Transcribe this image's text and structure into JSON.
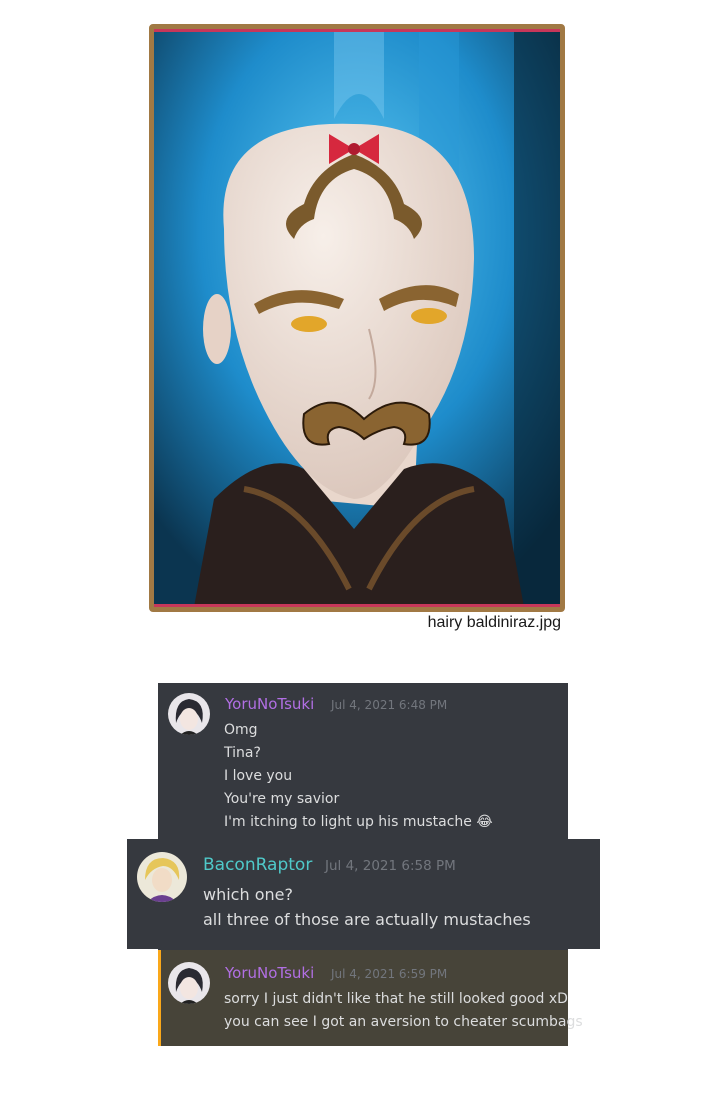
{
  "image_caption": "hairy baldiniraz.jpg",
  "colors": {
    "chat_bg": "#36393f",
    "yoru_name": "#b16fe3",
    "bacon_name": "#4fc9c9",
    "timestamp": "#72767d",
    "message_text": "#dcddde",
    "mention_highlight_bg": "#474439",
    "mention_bar": "#faa81a",
    "frame_border": "#a17944"
  },
  "chat": {
    "message1": {
      "author": "YoruNoTsuki",
      "timestamp": "Jul 4, 2021 6:48 PM",
      "lines": [
        "Omg",
        "Tina?",
        "I love you",
        "You're my savior",
        "I'm itching to light up his mustache"
      ],
      "emoji": "😂"
    },
    "message2": {
      "author": "BaconRaptor",
      "timestamp": "Jul 4, 2021 6:58 PM",
      "lines": [
        "which one?",
        "all three of those are actually mustaches"
      ]
    },
    "message3": {
      "author": "YoruNoTsuki",
      "timestamp": "Jul 4, 2021 6:59 PM",
      "lines": [
        "sorry I just didn't like that he still looked good xD",
        "you can see I got an aversion to cheater scumbags"
      ]
    }
  }
}
